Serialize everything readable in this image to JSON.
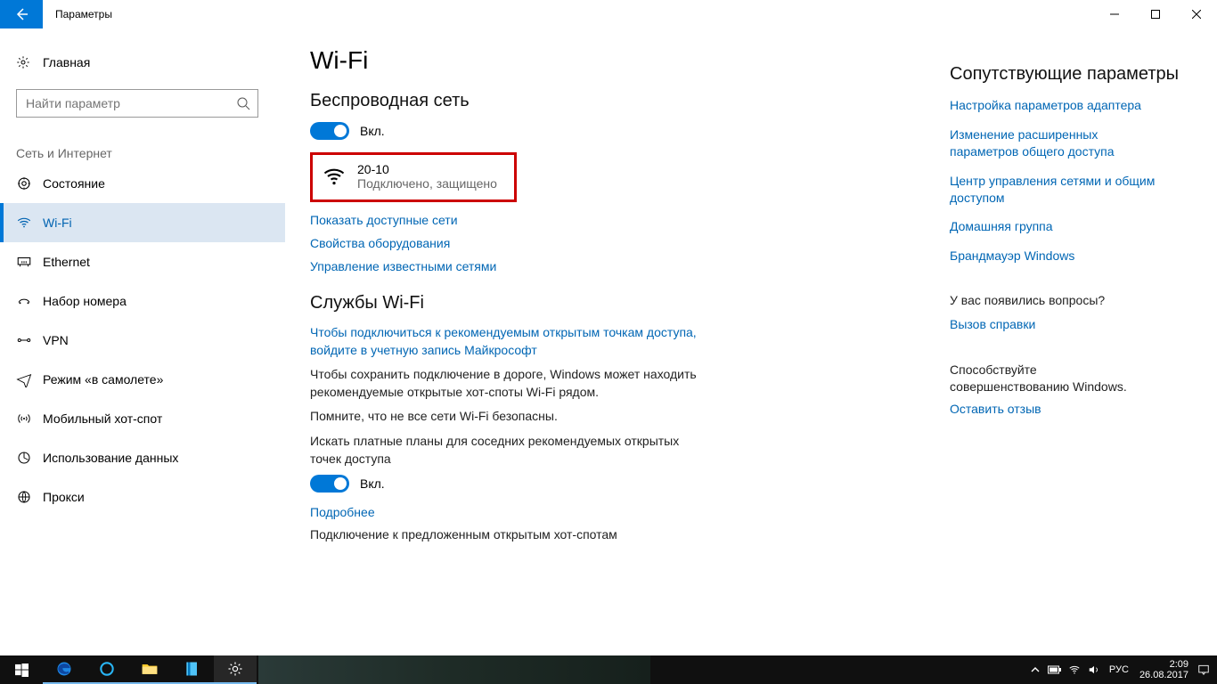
{
  "titlebar": {
    "title": "Параметры"
  },
  "sidebar": {
    "home": "Главная",
    "search_placeholder": "Найти параметр",
    "category": "Сеть и Интернет",
    "items": [
      {
        "label": "Состояние"
      },
      {
        "label": "Wi-Fi"
      },
      {
        "label": "Ethernet"
      },
      {
        "label": "Набор номера"
      },
      {
        "label": "VPN"
      },
      {
        "label": "Режим «в самолете»"
      },
      {
        "label": "Мобильный хот-спот"
      },
      {
        "label": "Использование данных"
      },
      {
        "label": "Прокси"
      }
    ]
  },
  "main": {
    "title": "Wi-Fi",
    "wireless_heading": "Беспроводная сеть",
    "on_label": "Вкл.",
    "network": {
      "name": "20-10",
      "status": "Подключено, защищено"
    },
    "links": {
      "show_networks": "Показать доступные сети",
      "hw_props": "Свойства оборудования",
      "manage_known": "Управление известными сетями"
    },
    "services_heading": "Службы Wi-Fi",
    "signin_link": "Чтобы подключиться к рекомендуемым открытым точкам доступа, войдите в учетную запись Майкрософт",
    "para1": "Чтобы сохранить подключение в дороге, Windows может находить рекомендуемые открытые хот-споты Wi-Fi рядом.",
    "para2": "Помните, что не все сети Wi-Fi безопасны.",
    "para3": "Искать платные планы для соседних рекомендуемых открытых точек доступа",
    "more_link": "Подробнее",
    "para4": "Подключение к предложенным открытым хот-спотам"
  },
  "rail": {
    "related_heading": "Сопутствующие параметры",
    "links": [
      "Настройка параметров адаптера",
      "Изменение расширенных параметров общего доступа",
      "Центр управления сетями и общим доступом",
      "Домашняя группа",
      "Брандмауэр Windows"
    ],
    "help_heading": "У вас появились вопросы?",
    "help_link": "Вызов справки",
    "feedback_heading": "Способствуйте совершенствованию Windows.",
    "feedback_link": "Оставить отзыв"
  },
  "taskbar": {
    "lang": "РУС",
    "time": "2:09",
    "date": "26.08.2017"
  }
}
